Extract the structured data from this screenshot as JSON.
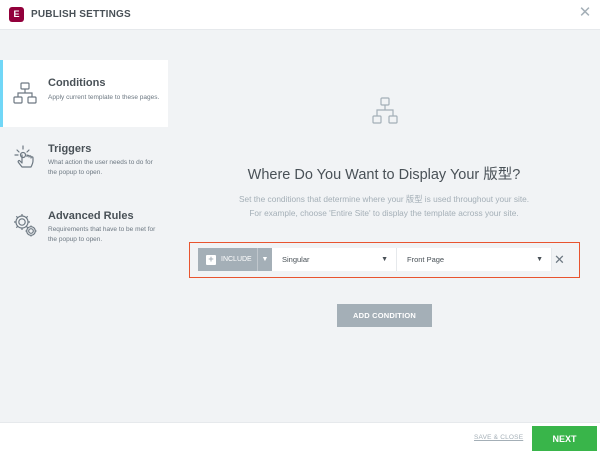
{
  "header": {
    "logo_letter": "E",
    "title": "PUBLISH SETTINGS",
    "close_symbol": "✕"
  },
  "sidebar": {
    "items": [
      {
        "name": "Conditions",
        "description": "Apply current template to these pages.",
        "icon": "sitemap-icon",
        "active": true
      },
      {
        "name": "Triggers",
        "description": "What action the user needs to do for the popup to open.",
        "icon": "click-hand-icon",
        "active": false
      },
      {
        "name": "Advanced Rules",
        "description": "Requirements that have to be met for the popup to open.",
        "icon": "gears-icon",
        "active": false
      }
    ]
  },
  "main": {
    "icon": "sitemap-icon",
    "heading": "Where Do You Want to Display Your 版型?",
    "description_line1": "Set the conditions that determine where your 版型 is used throughout your site.",
    "description_line2": "For example, choose 'Entire Site' to display the template across your site.",
    "condition": {
      "include_label": "INCLUDE",
      "type_value": "Singular",
      "target_value": "Front Page"
    },
    "add_condition_label": "ADD CONDITION"
  },
  "footer": {
    "save_close_label": "SAVE & CLOSE",
    "next_label": "NEXT"
  },
  "colors": {
    "brand": "#92003b",
    "active_accent": "#71d7f7",
    "highlight_frame": "#e8542f",
    "next_green": "#39b54a",
    "neutral_button": "#a4afb7"
  }
}
